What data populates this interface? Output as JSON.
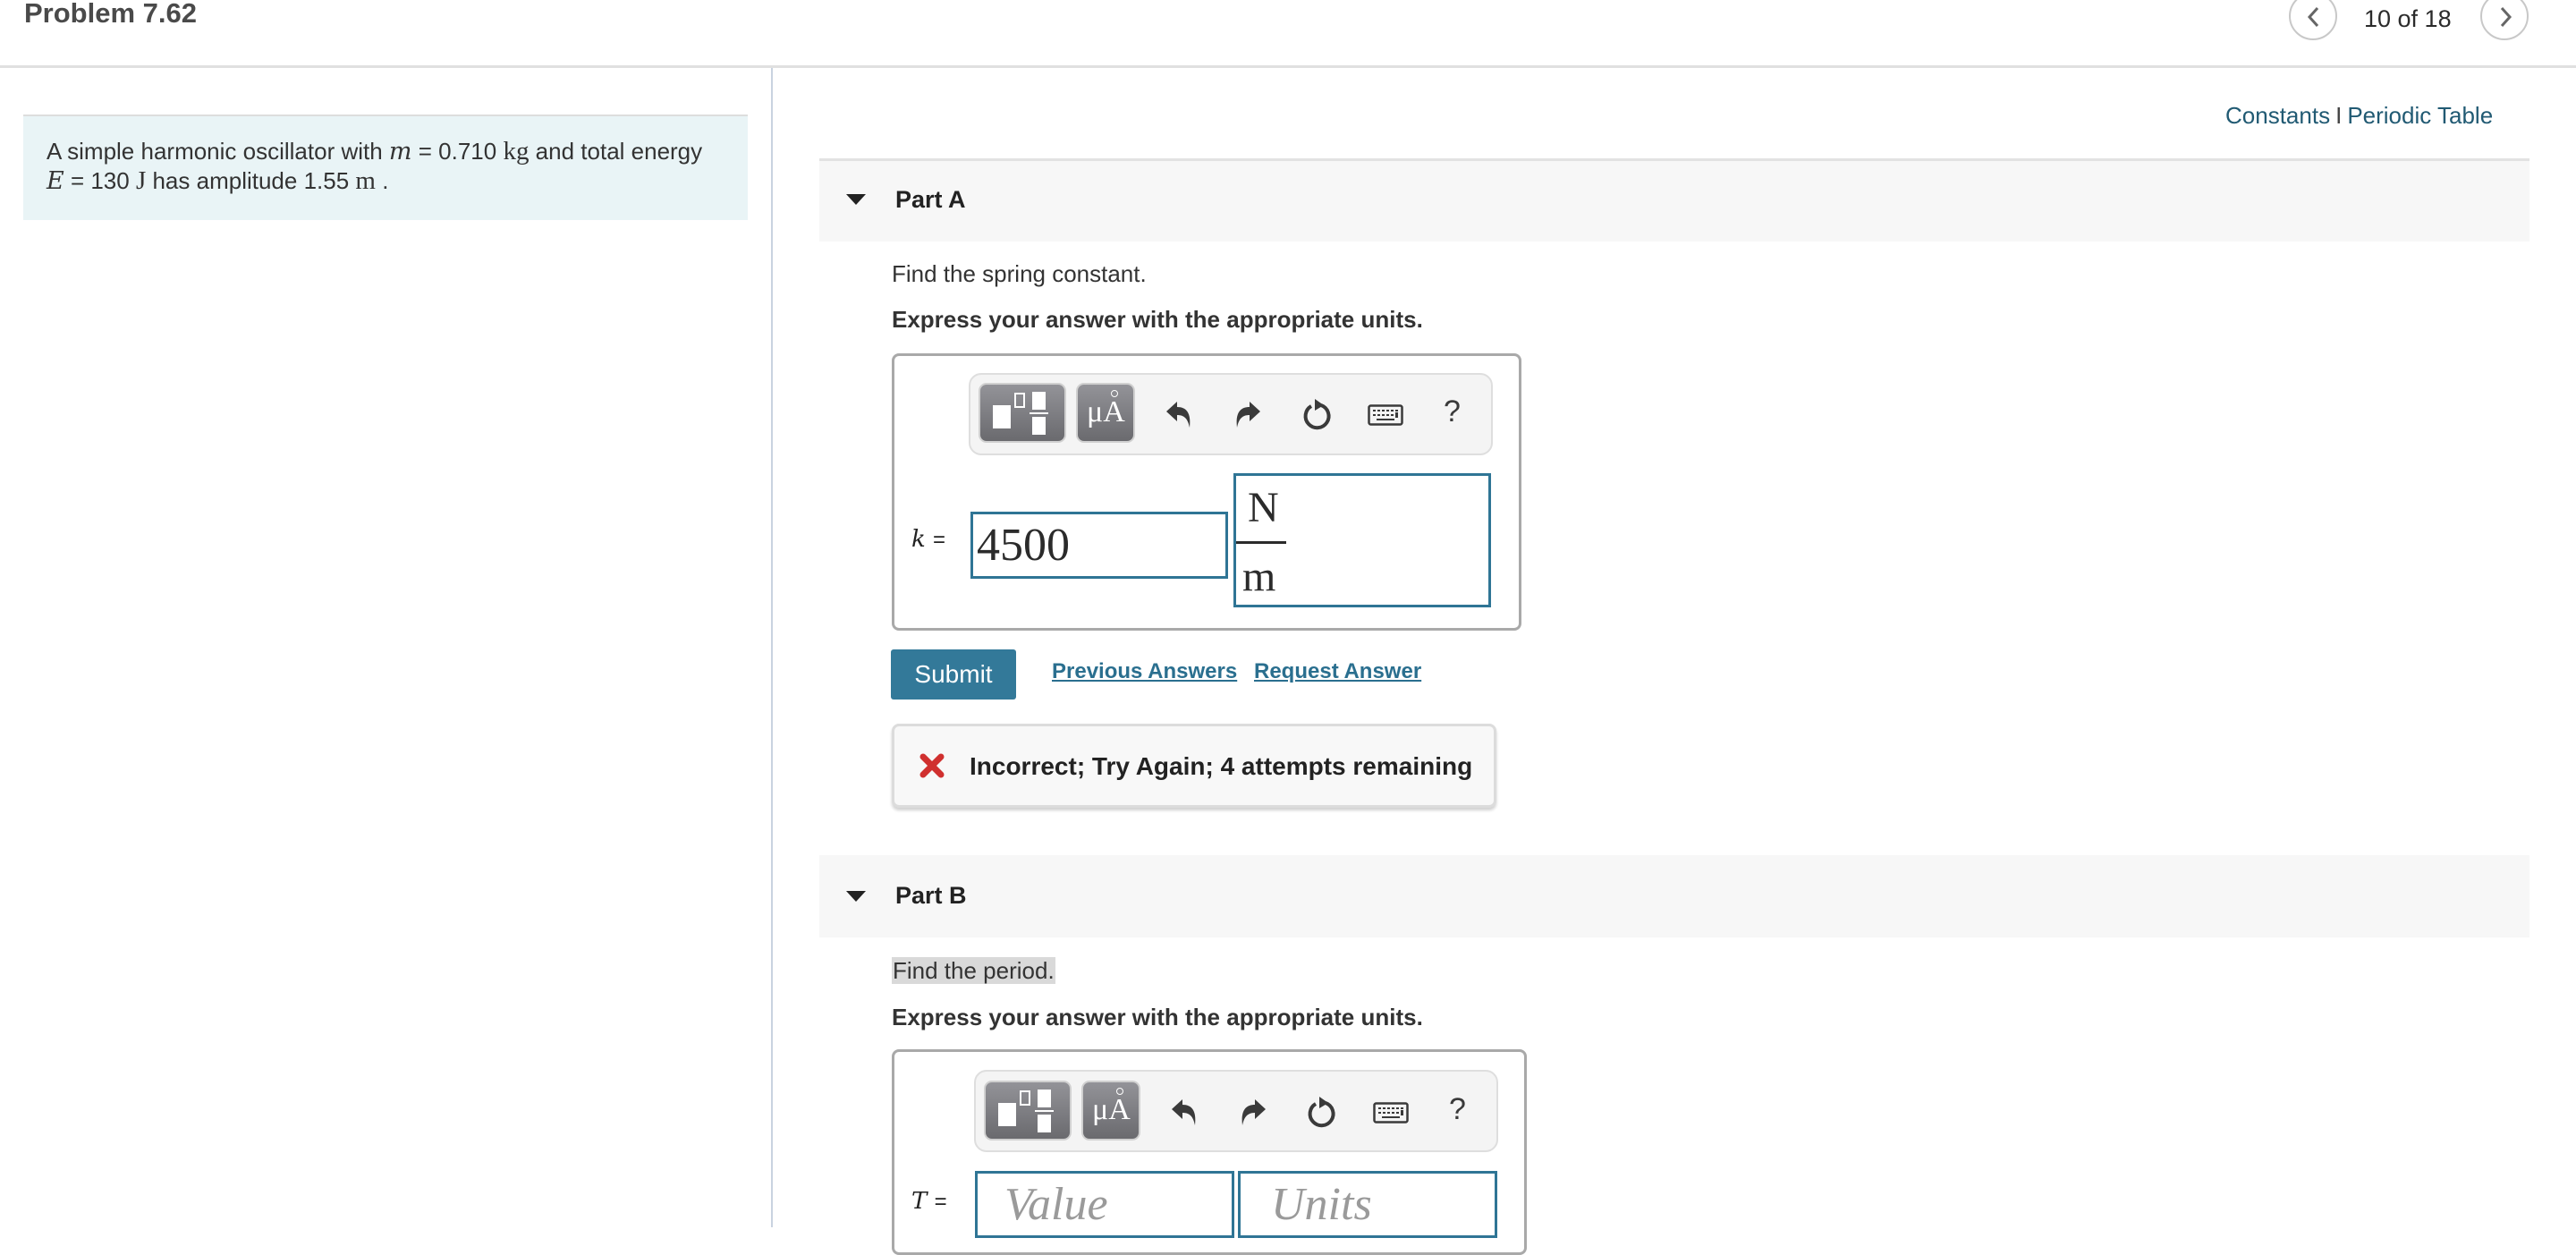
{
  "header": {
    "title": "Problem 7.62",
    "position": "10 of 18",
    "prev_icon": "chevron-left-icon",
    "next_icon": "chevron-right-icon"
  },
  "intro": {
    "text_1": "A simple harmonic oscillator with ",
    "m_var": "m",
    "text_2": " = 0.710 ",
    "m_unit": "kg",
    "text_3": " and total energy",
    "E_var": "E",
    "text_4": " = 130 ",
    "E_unit": "J",
    "text_5": " has amplitude 1.55 ",
    "A_unit": "m",
    "text_6": " ."
  },
  "links": {
    "constants": "Constants",
    "separator": "I",
    "periodic_table": "Periodic Table"
  },
  "partA": {
    "title": "Part A",
    "question": "Find the spring constant.",
    "instruction": "Express your answer with the appropriate units.",
    "variable": "k",
    "equals": "=",
    "value": "4500",
    "unit_numerator": "N",
    "unit_denominator": "m",
    "submit_label": "Submit",
    "previous_answers_label": "Previous Answers",
    "request_answer_label": "Request Answer",
    "feedback": "Incorrect; Try Again; 4 attempts remaining"
  },
  "partB": {
    "title": "Part B",
    "question": "Find the period.",
    "instruction": "Express your answer with the appropriate units.",
    "variable": "T",
    "equals": "=",
    "value_placeholder": "Value",
    "units_placeholder": "Units"
  },
  "toolbar": {
    "templates_icon": "fraction-templates-icon",
    "symbols_label": "μA",
    "undo_icon": "undo-icon",
    "redo_icon": "redo-icon",
    "reset_icon": "reset-icon",
    "keyboard_icon": "keyboard-icon",
    "help_label": "?"
  },
  "colors": {
    "accent": "#337999",
    "link": "#215a73",
    "input_border": "#2f7595",
    "error": "#d0302f",
    "intro_bg": "#e9f4f6"
  }
}
